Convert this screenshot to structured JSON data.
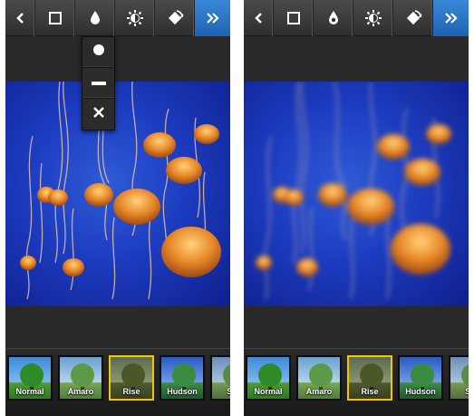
{
  "screens": [
    {
      "id": "left",
      "toolbar": {
        "items": [
          {
            "name": "back-icon"
          },
          {
            "name": "border-icon"
          },
          {
            "name": "tilt-shift-icon"
          },
          {
            "name": "lux-icon"
          },
          {
            "name": "rotate-icon"
          },
          {
            "name": "forward-icon"
          }
        ]
      },
      "tilt_shift_menu": {
        "visible": true,
        "options": [
          {
            "name": "radial-icon"
          },
          {
            "name": "linear-icon"
          },
          {
            "name": "off-icon"
          }
        ]
      },
      "photo": {
        "blurred": false
      },
      "filters": [
        {
          "label": "Normal",
          "selected": false
        },
        {
          "label": "Amaro",
          "selected": false
        },
        {
          "label": "Rise",
          "selected": true
        },
        {
          "label": "Hudson",
          "selected": false
        },
        {
          "label": "Sie",
          "selected": false
        }
      ]
    },
    {
      "id": "right",
      "toolbar": {
        "items": [
          {
            "name": "back-icon"
          },
          {
            "name": "border-icon"
          },
          {
            "name": "tilt-shift-icon"
          },
          {
            "name": "lux-icon"
          },
          {
            "name": "rotate-icon"
          },
          {
            "name": "forward-icon"
          }
        ]
      },
      "tilt_shift_menu": {
        "visible": false
      },
      "photo": {
        "blurred": true
      },
      "filters": [
        {
          "label": "Normal",
          "selected": false
        },
        {
          "label": "Amaro",
          "selected": false
        },
        {
          "label": "Rise",
          "selected": true
        },
        {
          "label": "Hudson",
          "selected": false
        },
        {
          "label": "Sie",
          "selected": false
        }
      ]
    }
  ],
  "colors": {
    "accent_blue": "#2a74c9",
    "selected_border": "#f0c800",
    "toolbar_bg": "#3a3a3a",
    "ocean_blue": "#1c3cc0",
    "jellyfish_orange": "#e8892a"
  }
}
